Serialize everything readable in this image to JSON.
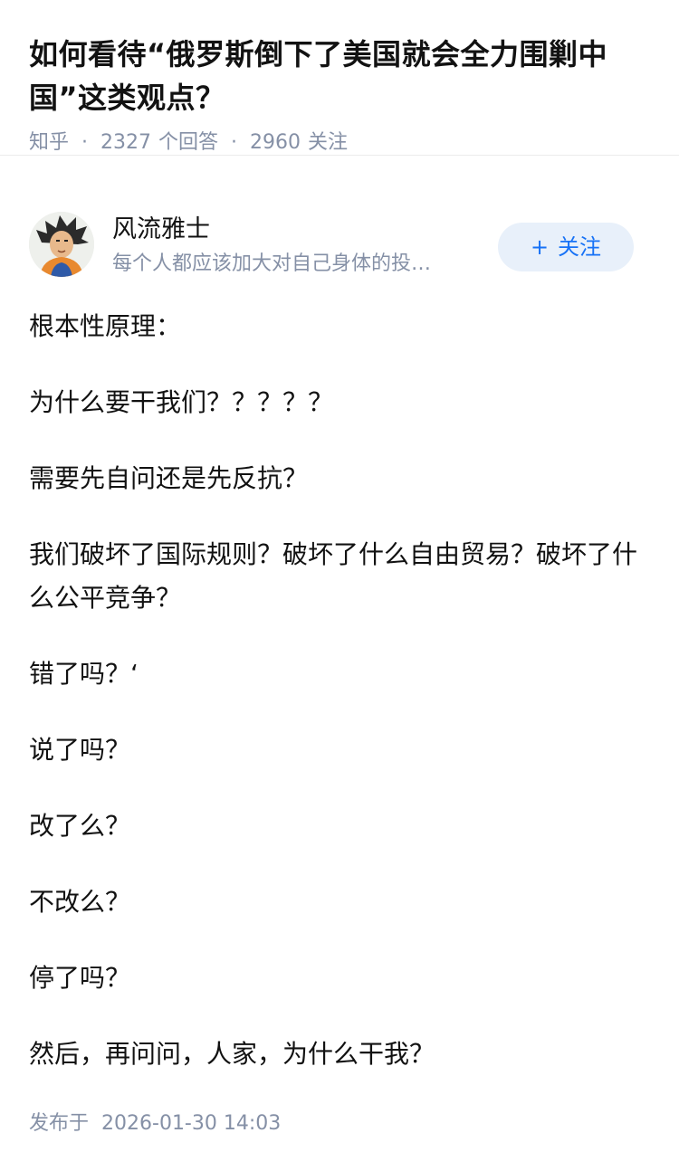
{
  "question": {
    "title": "如何看待“俄罗斯倒下了美国就会全力围剿中国”这类观点？",
    "source": "知乎",
    "answers_count": "2327",
    "answers_label": "个回答",
    "followers_count": "2960",
    "followers_label": "关注"
  },
  "author": {
    "name": "风流雅士",
    "headline": "每个人都应该加大对自己身体的投…",
    "follow_plus": "+",
    "follow_label": "关注"
  },
  "answer": {
    "paragraphs": [
      "根本性原理：",
      "为什么要干我们？？？？？",
      "需要先自问还是先反抗？",
      "我们破坏了国际规则？破坏了什么自由贸易？破坏了什么公平竞争？",
      "错了吗？‘",
      "说了吗？",
      "改了么？",
      "不改么？",
      "停了吗？",
      "然后，再问问，人家，为什么干我？"
    ]
  },
  "footer": {
    "publish_label": "发布于",
    "publish_time": "2026-01-30 14:03"
  }
}
